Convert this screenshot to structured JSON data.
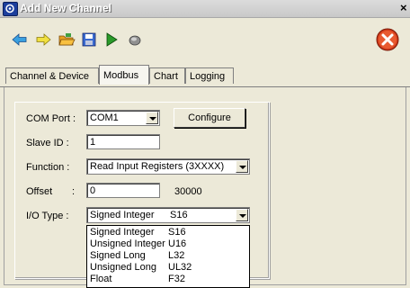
{
  "window": {
    "title": "Add New Channel",
    "close_glyph": "×"
  },
  "toolbar": {
    "icons": [
      "arrow-left-icon",
      "arrow-right-icon",
      "open-folder-icon",
      "save-icon",
      "play-icon",
      "record-icon"
    ],
    "close_icon": "close-circle-icon"
  },
  "tabs": [
    {
      "label": "Channel & Device"
    },
    {
      "label": "Modbus"
    },
    {
      "label": "Chart"
    },
    {
      "label": "Logging"
    }
  ],
  "modbus": {
    "com_port_label": "COM Port :",
    "com_port_value": "COM1",
    "configure_label": "Configure",
    "slave_id_label": "Slave ID :",
    "slave_id_value": "1",
    "function_label": "Function :",
    "function_value": "Read Input Registers (3XXXX)",
    "offset_label": "Offset",
    "offset_colon": ":",
    "offset_value": "0",
    "offset_address": "30000",
    "io_type_label": "I/O Type :",
    "io_type_value": "Signed Integer",
    "io_type_code": "S16",
    "io_type_options": [
      {
        "label": "Signed Integer",
        "code": "S16"
      },
      {
        "label": "Unsigned Integer",
        "code": "U16"
      },
      {
        "label": "Signed Long",
        "code": "L32"
      },
      {
        "label": "Unsigned Long",
        "code": "UL32"
      },
      {
        "label": "Float",
        "code": "F32"
      }
    ]
  },
  "colors": {
    "accent_green": "#2a9a2a",
    "close_red": "#d03a1a",
    "title_blue": "#1c3e9c"
  }
}
